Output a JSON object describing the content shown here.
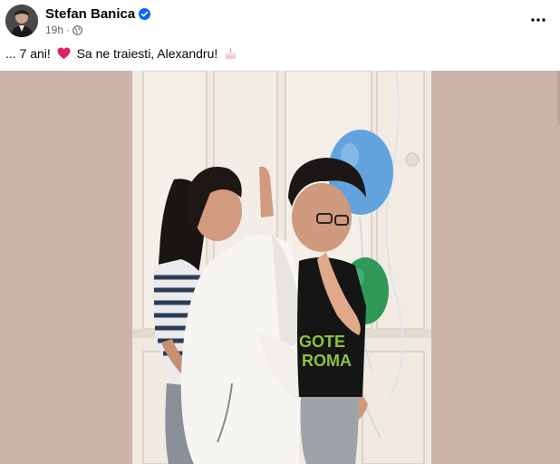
{
  "post": {
    "author": "Stefan Banica",
    "verified": true,
    "time": "19h",
    "separator": "·",
    "audience_icon": "globe-icon",
    "more_icon": "more-dots-icon",
    "caption": {
      "part1": "... 7 ani! ",
      "part2": " Sa ne traiesti, Alexandru! ",
      "emoji1": "red-heart-icon",
      "emoji2": "birthday-cake-icon"
    },
    "media_type": "photo"
  },
  "colors": {
    "verified_blue": "#0866ff",
    "meta_gray": "#65676b",
    "photo_background": "#cbb3a8",
    "heart_red": "#e0245e"
  }
}
